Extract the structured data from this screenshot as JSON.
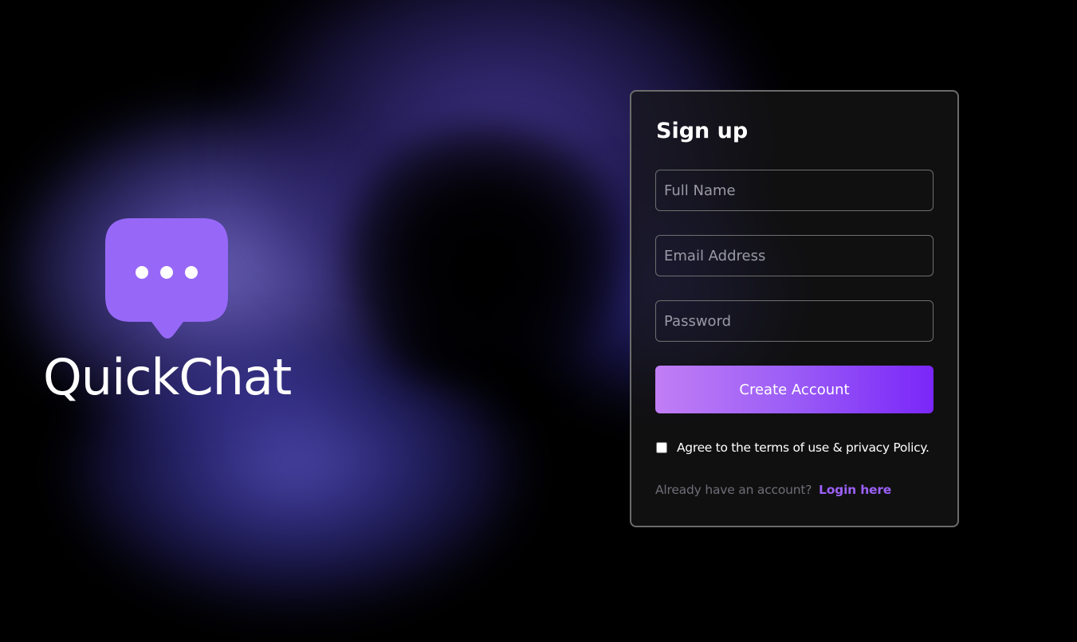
{
  "brand": {
    "name": "QuickChat",
    "icon": "chat-bubble-icon",
    "icon_color": "#9768f8"
  },
  "signup": {
    "title": "Sign up",
    "full_name": {
      "value": "",
      "placeholder": "Full Name"
    },
    "email": {
      "value": "",
      "placeholder": "Email Address"
    },
    "password": {
      "value": "",
      "placeholder": "Password"
    },
    "submit_label": "Create Account",
    "terms": {
      "checked": false,
      "label": "Agree to the terms of use & privacy Policy."
    },
    "login_prompt": "Already have an account?",
    "login_link": "Login here"
  },
  "colors": {
    "accent": "#9b60f6",
    "button_gradient_start": "#c17ef5",
    "button_gradient_end": "#7a26f8",
    "card_border": "#6b6b6b",
    "background": "#000000"
  }
}
